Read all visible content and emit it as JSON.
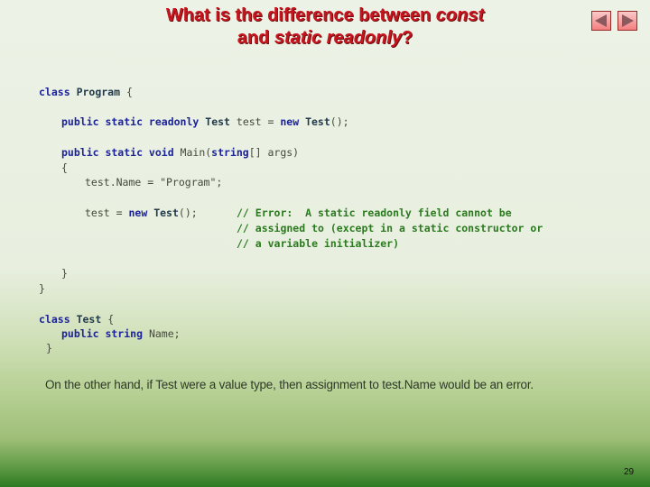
{
  "slide": {
    "title_line1_plain": "What is the difference between ",
    "title_line1_em": "const",
    "title_line2_plain": "and ",
    "title_line2_em": "static readonly",
    "title_line2_end": "?",
    "page_number": "29",
    "nav": {
      "prev_icon": "triangle-left-icon",
      "next_icon": "triangle-right-icon"
    }
  },
  "code": {
    "l1": {
      "kw": "class",
      "ty": "Program",
      "tx": " {"
    },
    "l2": {
      "kw1": "public static readonly",
      "ty": "Test",
      "tx1": " test = ",
      "kw2": "new",
      "ty2": "Test",
      "tx2": "();"
    },
    "l3": {
      "kw1": "public static void",
      "tx1": " Main(",
      "kw2": "string",
      "tx2": "[] args)"
    },
    "l4": {
      "tx": "{"
    },
    "l5": {
      "tx": "test.Name = \"Program\";"
    },
    "l6": {
      "tx1": "test = ",
      "kw": "new",
      "ty": "Test",
      "tx2": "();",
      "cm": "// Error:  A static readonly field cannot be"
    },
    "l7": {
      "cm": "// assigned to (except in a static constructor or"
    },
    "l8": {
      "cm": "// a variable initializer)"
    },
    "l9": {
      "tx": "}"
    },
    "l10": {
      "tx": "}"
    },
    "l11": {
      "kw": "class",
      "ty": "Test",
      "tx": " {"
    },
    "l12": {
      "kw": "public string",
      "tx": " Name;"
    },
    "l13": {
      "tx": "}"
    }
  },
  "note": "On the other hand, if Test were a value type, then assignment to test.Name would be an error."
}
